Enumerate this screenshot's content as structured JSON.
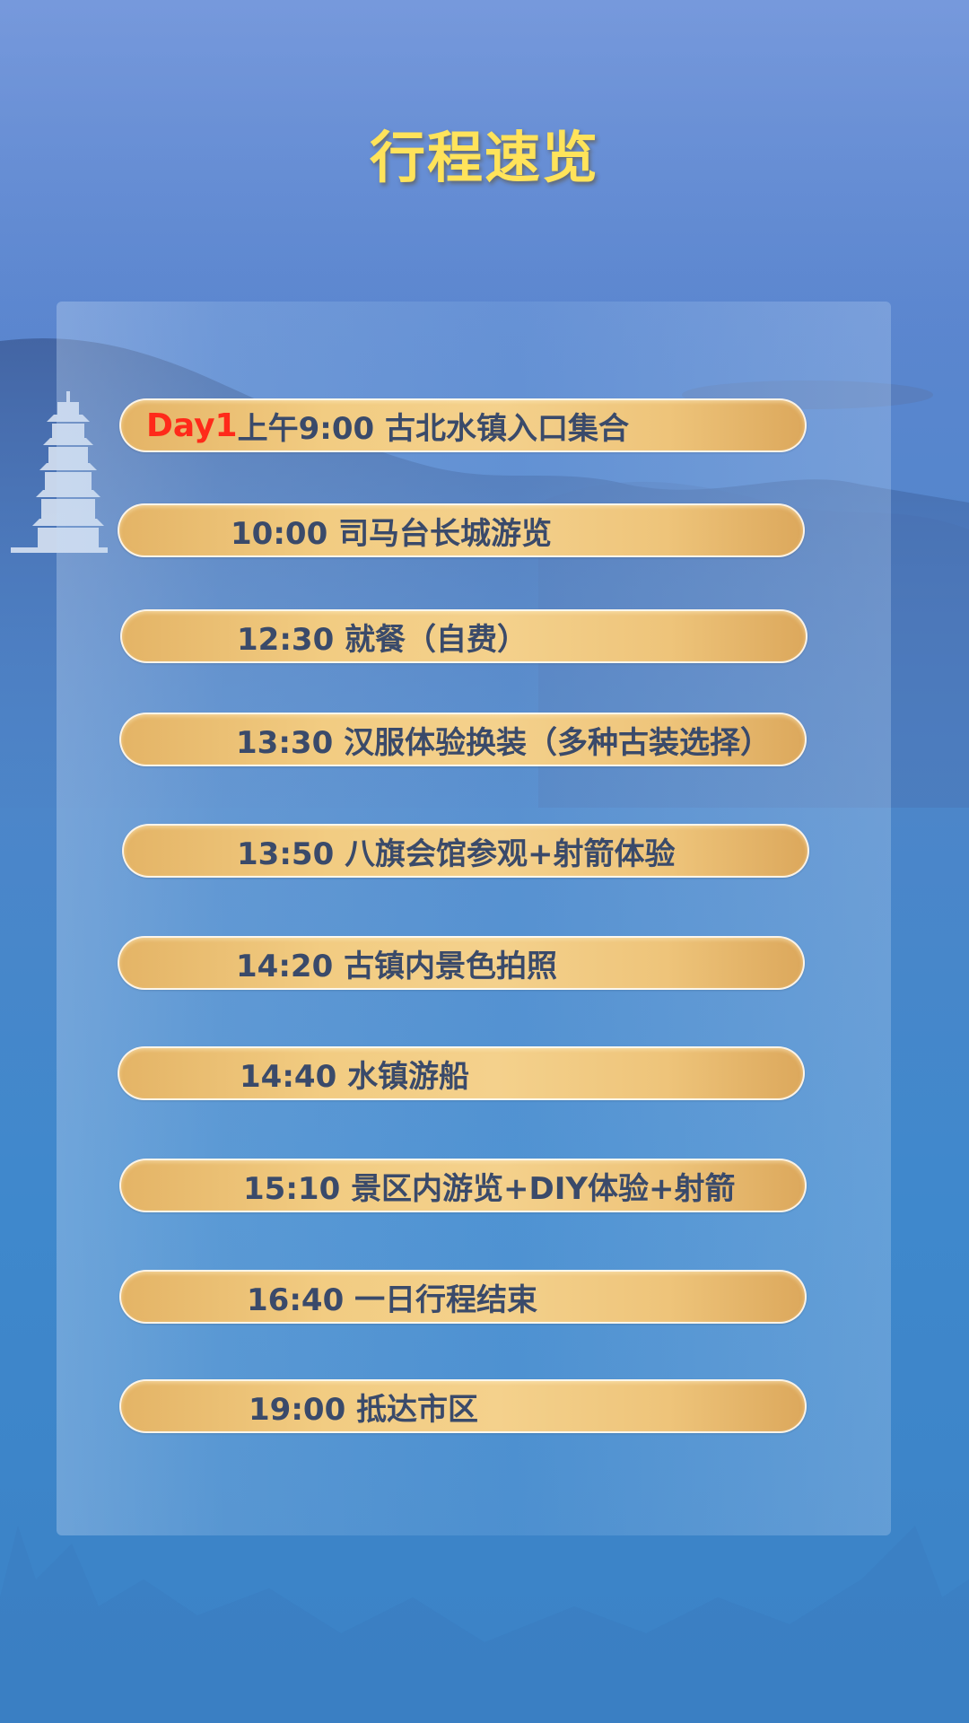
{
  "title": "行程速览",
  "day_tag": "Day1",
  "items": [
    {
      "text": "上午9:00 古北水镇入口集合"
    },
    {
      "text": "10:00 司马台长城游览"
    },
    {
      "text": "12:30 就餐（自费）"
    },
    {
      "text": "13:30 汉服体验换装（多种古装选择）"
    },
    {
      "text": "13:50 八旗会馆参观+射箭体验"
    },
    {
      "text": "14:20 古镇内景色拍照"
    },
    {
      "text": "14:40 水镇游船"
    },
    {
      "text": "15:10 景区内游览+DIY体验+射箭"
    },
    {
      "text": "16:40 一日行程结束"
    },
    {
      "text": "19:00 抵达市区"
    }
  ],
  "colors": {
    "title": "#ffe35a",
    "day_tag": "#ff2a1a",
    "pill_text": "#3a4a6a"
  },
  "icons": [
    "pagoda-illustration",
    "mountain-illustration"
  ]
}
